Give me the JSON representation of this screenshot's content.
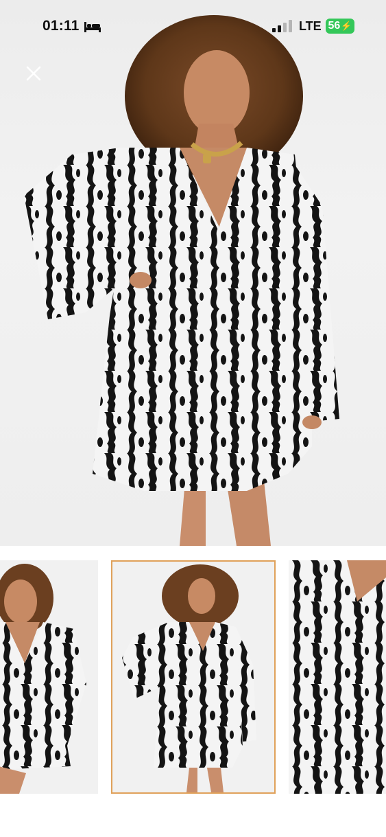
{
  "status_bar": {
    "time": "01:11",
    "network": "LTE",
    "battery": "56"
  },
  "icons": {
    "close": "close-icon",
    "sleep": "bed-icon",
    "signal": "signal-icon",
    "charging": "bolt-icon"
  },
  "gallery": {
    "selected_index": 1,
    "thumbnail_count": 3
  },
  "colors": {
    "battery": "#34c759",
    "selected_border": "#e0a15a",
    "background": "#ffffff"
  }
}
